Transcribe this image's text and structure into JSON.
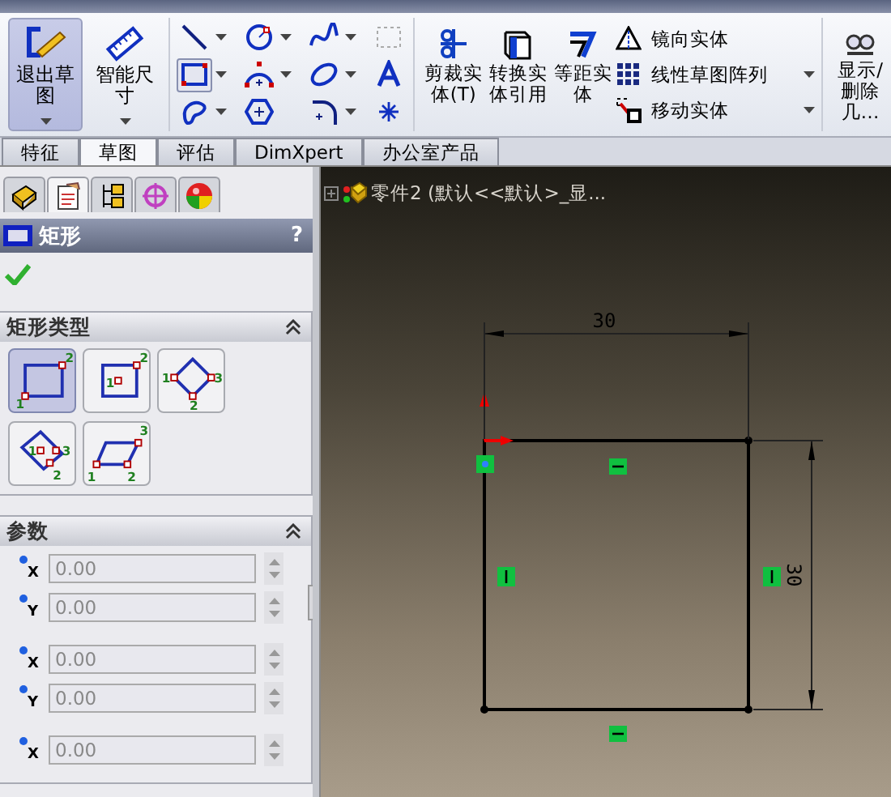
{
  "toolbar": {
    "large_buttons": [
      {
        "kind": "exit",
        "label": "退出草图",
        "selected": true
      },
      {
        "kind": "dimension",
        "label": "智能尺寸",
        "selected": false
      }
    ],
    "tools": [
      {
        "kind": "line",
        "has_menu": true,
        "selected": false
      },
      {
        "kind": "circle",
        "has_menu": true,
        "selected": false
      },
      {
        "kind": "spline",
        "has_menu": true,
        "selected": false
      },
      {
        "kind": "grid",
        "has_menu": false,
        "selected": false
      },
      {
        "kind": "rectangle",
        "has_menu": true,
        "selected": true
      },
      {
        "kind": "arc",
        "has_menu": true,
        "selected": false
      },
      {
        "kind": "ellipse",
        "has_menu": true,
        "selected": false
      },
      {
        "kind": "text",
        "has_menu": false,
        "selected": false
      },
      {
        "kind": "slot",
        "has_menu": true,
        "selected": false
      },
      {
        "kind": "polygon",
        "has_menu": false,
        "selected": false
      },
      {
        "kind": "fillet",
        "has_menu": true,
        "selected": false
      },
      {
        "kind": "point",
        "has_menu": false,
        "selected": false
      }
    ],
    "commands": [
      {
        "kind": "trim",
        "label": "剪裁实体(T)"
      },
      {
        "kind": "convert",
        "label": "转换实体引用"
      },
      {
        "kind": "offset",
        "label": "等距实体"
      }
    ],
    "list_commands": [
      {
        "kind": "mirror",
        "label": "镜向实体",
        "has_menu": false
      },
      {
        "kind": "pattern",
        "label": "线性草图阵列",
        "has_menu": true
      },
      {
        "kind": "move",
        "label": "移动实体",
        "has_menu": true
      }
    ],
    "display_button": {
      "label": "显示/删除几…"
    }
  },
  "tabs": [
    {
      "label": "特征",
      "selected": false
    },
    {
      "label": "草图",
      "selected": true
    },
    {
      "label": "评估",
      "selected": false
    },
    {
      "label": "DimXpert",
      "selected": false
    },
    {
      "label": "办公室产品",
      "selected": false
    }
  ],
  "panel": {
    "icon_tabs": [
      {
        "kind": "feature",
        "selected": false
      },
      {
        "kind": "property",
        "selected": true
      },
      {
        "kind": "config",
        "selected": false
      },
      {
        "kind": "target",
        "selected": false
      },
      {
        "kind": "appearance",
        "selected": false
      }
    ],
    "title": "矩形",
    "help": "?",
    "type_section": {
      "title": "矩形类型",
      "types": [
        {
          "kind": "corner",
          "selected": true,
          "points": [
            "1",
            "2"
          ]
        },
        {
          "kind": "center",
          "selected": false,
          "points": [
            "1",
            "2"
          ]
        },
        {
          "kind": "three-point-corner",
          "selected": false,
          "points": [
            "1",
            "2",
            "3"
          ]
        },
        {
          "kind": "three-point-center",
          "selected": false,
          "points": [
            "1",
            "2",
            "3"
          ]
        },
        {
          "kind": "parallelogram",
          "selected": false,
          "points": [
            "1",
            "2",
            "3"
          ]
        }
      ]
    },
    "param_section": {
      "title": "参数",
      "groups": [
        [
          {
            "axis": "X",
            "value": "0.00"
          },
          {
            "axis": "Y",
            "value": "0.00"
          }
        ],
        [
          {
            "axis": "X",
            "value": "0.00"
          },
          {
            "axis": "Y",
            "value": "0.00"
          }
        ],
        [
          {
            "axis": "X",
            "value": "0.00"
          }
        ]
      ]
    }
  },
  "viewport": {
    "tree_label": "零件2  (默认<<默认>_显...",
    "width_dimension": "30",
    "height_dimension": "30"
  }
}
